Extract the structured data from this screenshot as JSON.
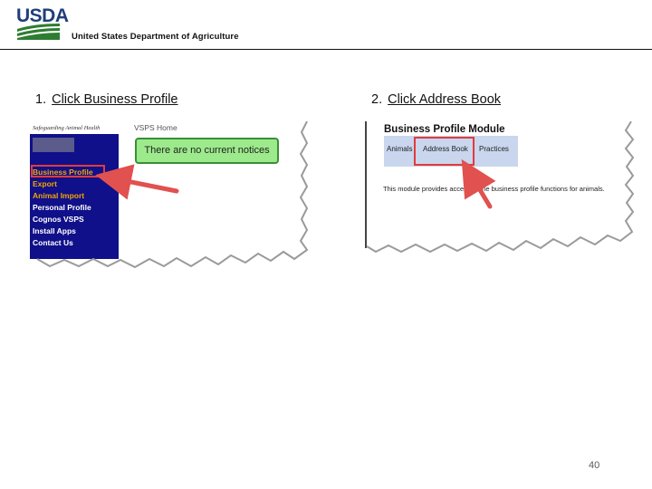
{
  "header": {
    "logo_text": "USDA",
    "department": "United States Department of Agriculture"
  },
  "steps": [
    {
      "number": "1.",
      "text": "Click Business Profile"
    },
    {
      "number": "2.",
      "text": "Click Address Book"
    }
  ],
  "screenshot1": {
    "brand_text": "Safeguarding Animal Health",
    "home_link": "VSPS Home",
    "notice": "There are no current notices",
    "menu": [
      {
        "label": "Business Profile",
        "color": "#f2a400"
      },
      {
        "label": "Export",
        "color": "#f2a400"
      },
      {
        "label": "Animal Import",
        "color": "#f2a400"
      },
      {
        "label": "Personal Profile",
        "color": "#ffffff"
      },
      {
        "label": "Cognos VSPS",
        "color": "#ffffff"
      },
      {
        "label": "Install Apps",
        "color": "#ffffff"
      },
      {
        "label": "Contact Us",
        "color": "#ffffff"
      }
    ]
  },
  "screenshot2": {
    "title": "Business Profile Module",
    "tabs": [
      "Animals",
      "Address Book",
      "Practices"
    ],
    "description": "This module provides access to the business profile functions for animals."
  },
  "colors": {
    "usda_blue": "#1f3f7a",
    "usda_green": "#2e7d32",
    "sidebar_navy": "#10108a",
    "highlight_red": "#e23b3b",
    "arrow_red": "#e0514f",
    "notice_green": "#9dea8c",
    "tab_blue": "#c9d6ee"
  },
  "page_number": "40"
}
